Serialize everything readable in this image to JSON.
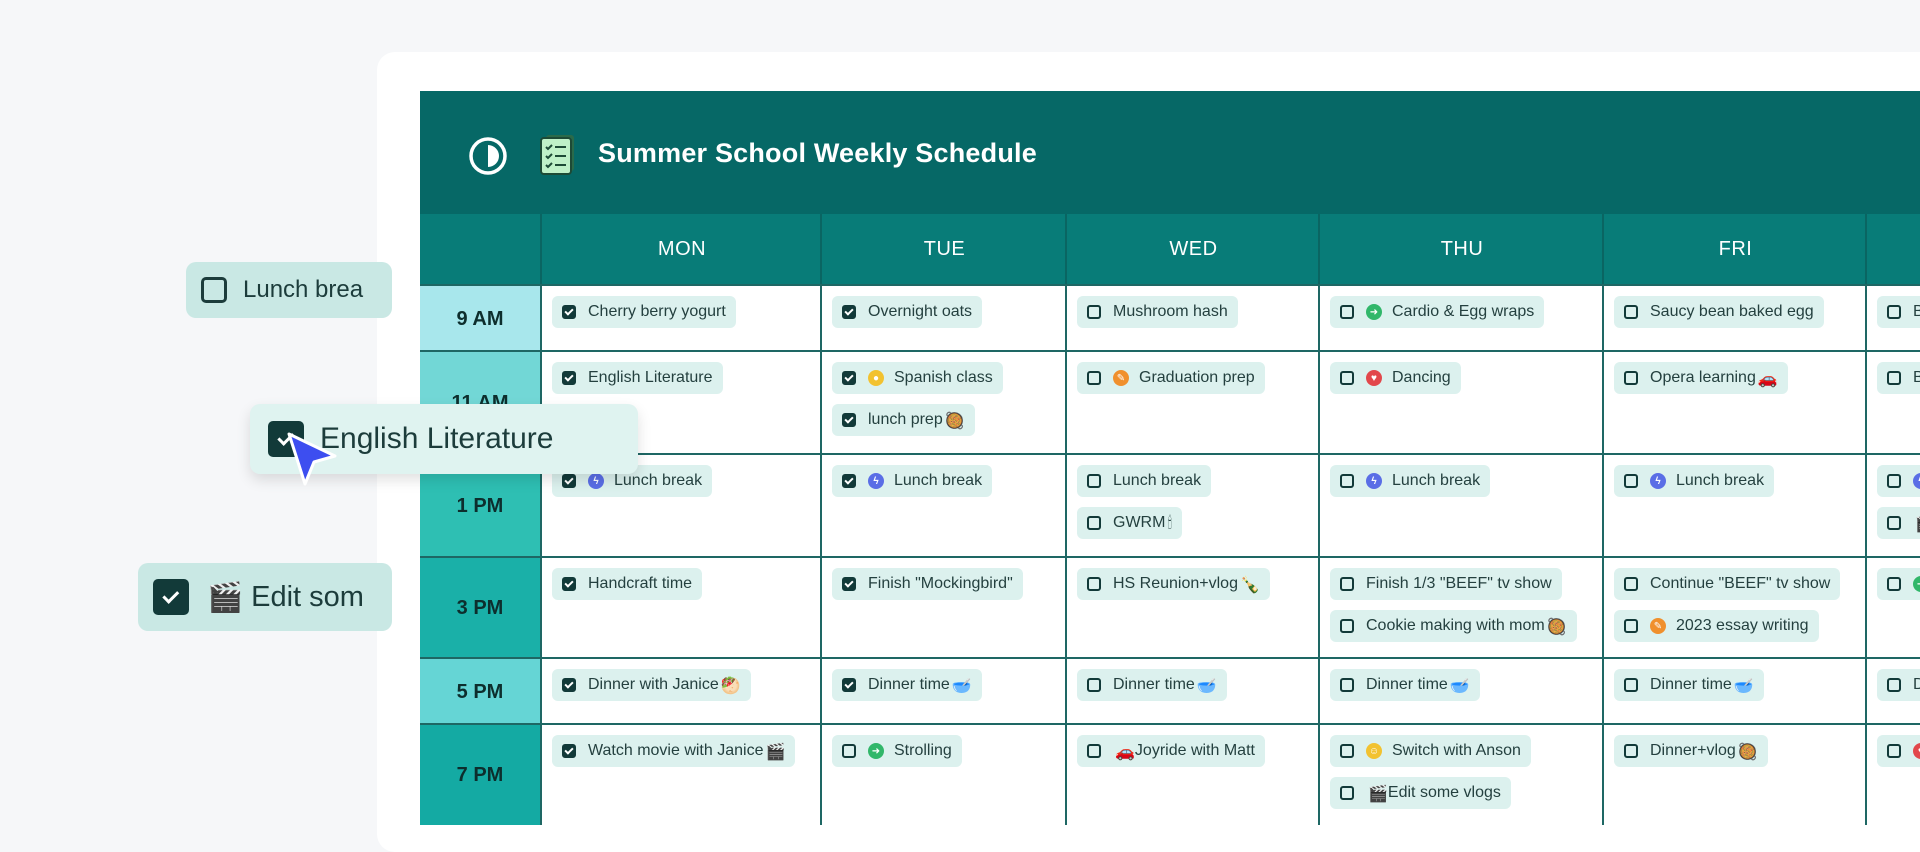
{
  "app": {
    "title": "Summer School Weekly Schedule",
    "accent_color": "#066866",
    "header_color": "#087c78",
    "icons": {
      "theme": "half-circle-icon",
      "title": "checklist-note-icon"
    }
  },
  "days": [
    "MON",
    "TUE",
    "WED",
    "THU",
    "FRI"
  ],
  "rows": [
    {
      "time": "9 AM",
      "cells": [
        [
          {
            "text": "Cherry berry yogurt",
            "checked": true
          }
        ],
        [
          {
            "text": "Overnight oats",
            "checked": true
          }
        ],
        [
          {
            "text": "Mushroom hash",
            "checked": false
          }
        ],
        [
          {
            "text": "Cardio & Egg wraps",
            "checked": false,
            "icon": "run-icon",
            "icon_color": "#31b76a"
          }
        ],
        [
          {
            "text": "Saucy bean baked egg",
            "checked": false
          }
        ],
        [
          {
            "text": "B",
            "checked": false
          }
        ]
      ]
    },
    {
      "time": "11 AM",
      "cells": [
        [
          {
            "text": "English Literature",
            "checked": true
          }
        ],
        [
          {
            "text": "Spanish class",
            "checked": true,
            "icon": "lightbulb-icon",
            "icon_color": "#f2c230"
          },
          {
            "text": "lunch prep",
            "checked": true,
            "emoji": "🥘"
          }
        ],
        [
          {
            "text": "Graduation prep",
            "checked": false,
            "icon": "pencil-icon",
            "icon_color": "#f0902d"
          }
        ],
        [
          {
            "text": "Dancing",
            "checked": false,
            "icon": "heart-icon",
            "icon_color": "#e2474b"
          }
        ],
        [
          {
            "text": "Opera learning",
            "checked": false,
            "emoji": "🚗"
          }
        ],
        [
          {
            "text": "B",
            "checked": false
          }
        ]
      ]
    },
    {
      "time": "1 PM",
      "cells": [
        [
          {
            "text": "Lunch break",
            "checked": true,
            "icon": "lightning-icon",
            "icon_color": "#5a6ee6"
          }
        ],
        [
          {
            "text": "Lunch break",
            "checked": true,
            "icon": "lightning-icon",
            "icon_color": "#5a6ee6"
          }
        ],
        [
          {
            "text": "Lunch break",
            "checked": false
          },
          {
            "text": "GWRM",
            "checked": false,
            "emoji": "🕯"
          }
        ],
        [
          {
            "text": "Lunch break",
            "checked": false,
            "icon": "lightning-icon",
            "icon_color": "#5a6ee6"
          }
        ],
        [
          {
            "text": "Lunch break",
            "checked": false,
            "icon": "lightning-icon",
            "icon_color": "#5a6ee6"
          }
        ],
        [
          {
            "text": "",
            "checked": false,
            "icon": "lightning-icon",
            "icon_color": "#5a6ee6"
          },
          {
            "text": "",
            "checked": false,
            "emoji": "🎬"
          }
        ]
      ]
    },
    {
      "time": "3 PM",
      "cells": [
        [
          {
            "text": "Handcraft time",
            "checked": true
          }
        ],
        [
          {
            "text": "Finish \"Mockingbird\"",
            "checked": true
          }
        ],
        [
          {
            "text": "HS Reunion+vlog",
            "checked": false,
            "emoji": "🍾"
          }
        ],
        [
          {
            "text": "Finish 1/3 \"BEEF\" tv show",
            "checked": false
          },
          {
            "text": "Cookie making with mom",
            "checked": false,
            "emoji": "🥘"
          }
        ],
        [
          {
            "text": "Continue \"BEEF\" tv show",
            "checked": false
          },
          {
            "text": "2023 essay writing",
            "checked": false,
            "icon": "pencil-icon",
            "icon_color": "#f0902d"
          }
        ],
        [
          {
            "text": "",
            "checked": false,
            "icon": "run-icon",
            "icon_color": "#31b76a"
          }
        ]
      ]
    },
    {
      "time": "5 PM",
      "cells": [
        [
          {
            "text": "Dinner with Janice",
            "checked": true,
            "emoji": "🥙"
          }
        ],
        [
          {
            "text": "Dinner time",
            "checked": true,
            "emoji": "🥣"
          }
        ],
        [
          {
            "text": "Dinner time",
            "checked": false,
            "emoji": "🥣"
          }
        ],
        [
          {
            "text": "Dinner time",
            "checked": false,
            "emoji": "🥣"
          }
        ],
        [
          {
            "text": "Dinner time",
            "checked": false,
            "emoji": "🥣"
          }
        ],
        [
          {
            "text": "D",
            "checked": false
          }
        ]
      ]
    },
    {
      "time": "7 PM",
      "cells": [
        [
          {
            "text": "Watch movie with Janice",
            "checked": true,
            "emoji": "🎬"
          }
        ],
        [
          {
            "text": "Strolling",
            "checked": false,
            "icon": "run-icon",
            "icon_color": "#31b76a"
          }
        ],
        [
          {
            "text": "Joyride with Matt",
            "checked": false,
            "prefix": "🚗"
          }
        ],
        [
          {
            "text": "Switch with Anson",
            "checked": false,
            "icon": "smile-icon",
            "icon_color": "#f2c230"
          },
          {
            "text": "Edit some vlogs",
            "checked": false,
            "prefix": "🎬"
          }
        ],
        [
          {
            "text": "Dinner+vlog",
            "checked": false,
            "emoji": "🥘"
          }
        ],
        [
          {
            "text": "",
            "checked": false,
            "icon": "heart-icon",
            "icon_color": "#e2474b"
          }
        ]
      ]
    }
  ],
  "floating": {
    "lunch_chip": {
      "text": "Lunch brea",
      "checked": false
    },
    "drag_chip": {
      "text": "English Literature",
      "checked": true
    },
    "edit_chip": {
      "text": "Edit som",
      "checked": true,
      "prefix": "🎬"
    }
  }
}
